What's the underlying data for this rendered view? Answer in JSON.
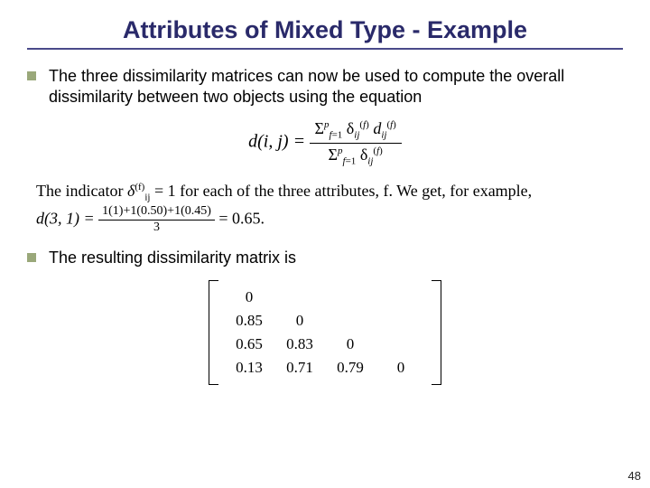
{
  "title": "Attributes of Mixed Type - Example",
  "bullets": {
    "b1": "The three dissimilarity matrices can now be used to compute the overall dissimilarity between two objects using the equation",
    "b2": "The resulting dissimilarity matrix is"
  },
  "formula": {
    "lhs": "d(i, j) =",
    "num": "∑ᵖ ₖ₌₁ δₖᶠₙ dₖᶠₙ",
    "num_plain": "Σ  δ  d",
    "den_plain": "Σ  δ"
  },
  "indicator": {
    "line1a": "The indicator ",
    "delta": "δ",
    "sup": "(f)",
    "sub": "ij",
    "line1b": " = 1 for each of the three attributes, f. We get, for example,",
    "d31_lhs": "d(3, 1) = ",
    "d31_num": "1(1)+1(0.50)+1(0.45)",
    "d31_den": "3",
    "d31_rhs": " = 0.65."
  },
  "matrix": {
    "rows": [
      [
        "0",
        "",
        "",
        ""
      ],
      [
        "0.85",
        "0",
        "",
        ""
      ],
      [
        "0.65",
        "0.83",
        "0",
        ""
      ],
      [
        "0.13",
        "0.71",
        "0.79",
        "0"
      ]
    ]
  },
  "page_number": "48",
  "chart_data": {
    "type": "table",
    "title": "Mixed-type dissimilarity matrix (lower triangular)",
    "rows": [
      [
        0,
        null,
        null,
        null
      ],
      [
        0.85,
        0,
        null,
        null
      ],
      [
        0.65,
        0.83,
        0,
        null
      ],
      [
        0.13,
        0.71,
        0.79,
        0
      ]
    ],
    "example_computation": {
      "pair": "d(3,1)",
      "terms": [
        1,
        0.5,
        0.45
      ],
      "weights": [
        1,
        1,
        1
      ],
      "divisor": 3,
      "result": 0.65
    }
  }
}
